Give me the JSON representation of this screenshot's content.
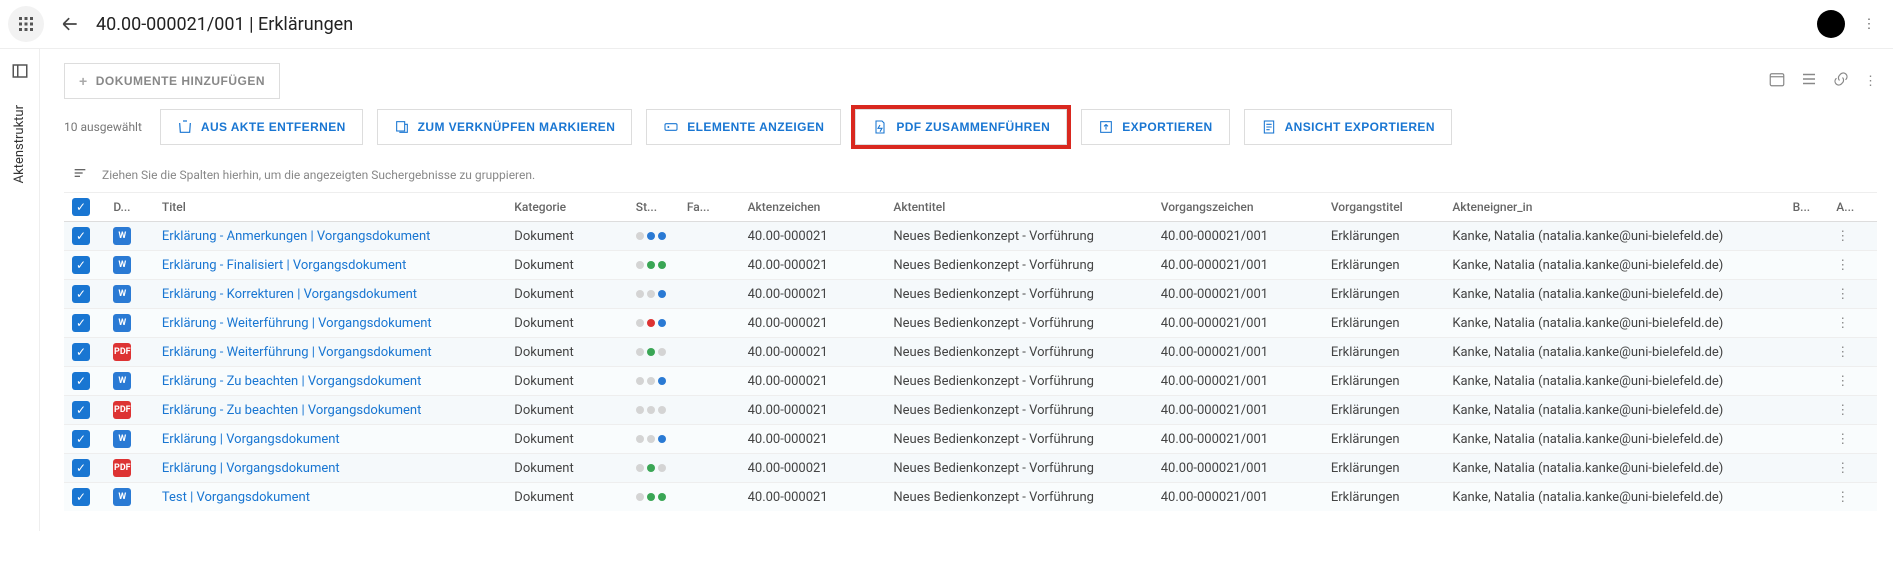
{
  "header": {
    "title": "40.00-000021/001 | Erklärungen"
  },
  "sidebar": {
    "vertical_label": "Aktenstruktur"
  },
  "toolbar": {
    "add_documents": "DOKUMENTE HINZUFÜGEN",
    "selected_count": "10 ausgewählt",
    "remove_from_file": "AUS AKTE ENTFERNEN",
    "mark_for_link": "ZUM VERKNÜPFEN MARKIEREN",
    "show_elements": "ELEMENTE ANZEIGEN",
    "merge_pdf": "PDF ZUSAMMENFÜHREN",
    "export": "EXPORTIEREN",
    "export_view": "ANSICHT EXPORTIEREN"
  },
  "grouper_hint": "Ziehen Sie die Spalten hierhin, um die angezeigten Suchergebnisse zu gruppieren.",
  "columns": {
    "d": "D...",
    "title": "Titel",
    "kategorie": "Kategorie",
    "st": "St...",
    "fa": "Fa...",
    "aktenzeichen": "Aktenzeichen",
    "aktentitel": "Aktentitel",
    "vorgangszeichen": "Vorgangszeichen",
    "vorgangstitel": "Vorgangstitel",
    "owner": "Akteneigner_in",
    "b": "B...",
    "a": "A..."
  },
  "rows": [
    {
      "icon": "w",
      "title": "Erklärung - Anmerkungen | Vorgangsdokument",
      "kat": "Dokument",
      "dots": [
        "grey",
        "blue",
        "blue"
      ],
      "az": "40.00-000021",
      "at": "Neues Bedienkonzept - Vorführung",
      "vz": "40.00-000021/001",
      "vt": "Erklärungen",
      "owner": "Kanke, Natalia (natalia.kanke@uni-bielefeld.de)"
    },
    {
      "icon": "w",
      "title": "Erklärung - Finalisiert | Vorgangsdokument",
      "kat": "Dokument",
      "dots": [
        "grey",
        "green",
        "green"
      ],
      "az": "40.00-000021",
      "at": "Neues Bedienkonzept - Vorführung",
      "vz": "40.00-000021/001",
      "vt": "Erklärungen",
      "owner": "Kanke, Natalia (natalia.kanke@uni-bielefeld.de)"
    },
    {
      "icon": "w",
      "title": "Erklärung - Korrekturen | Vorgangsdokument",
      "kat": "Dokument",
      "dots": [
        "grey",
        "grey",
        "blue"
      ],
      "az": "40.00-000021",
      "at": "Neues Bedienkonzept - Vorführung",
      "vz": "40.00-000021/001",
      "vt": "Erklärungen",
      "owner": "Kanke, Natalia (natalia.kanke@uni-bielefeld.de)"
    },
    {
      "icon": "w",
      "title": "Erklärung - Weiterführung | Vorgangsdokument",
      "kat": "Dokument",
      "dots": [
        "grey",
        "red",
        "blue"
      ],
      "az": "40.00-000021",
      "at": "Neues Bedienkonzept - Vorführung",
      "vz": "40.00-000021/001",
      "vt": "Erklärungen",
      "owner": "Kanke, Natalia (natalia.kanke@uni-bielefeld.de)"
    },
    {
      "icon": "pdf",
      "title": "Erklärung - Weiterführung | Vorgangsdokument",
      "kat": "Dokument",
      "dots": [
        "grey",
        "green",
        "grey"
      ],
      "az": "40.00-000021",
      "at": "Neues Bedienkonzept - Vorführung",
      "vz": "40.00-000021/001",
      "vt": "Erklärungen",
      "owner": "Kanke, Natalia (natalia.kanke@uni-bielefeld.de)"
    },
    {
      "icon": "w",
      "title": "Erklärung - Zu beachten | Vorgangsdokument",
      "kat": "Dokument",
      "dots": [
        "grey",
        "grey",
        "blue"
      ],
      "az": "40.00-000021",
      "at": "Neues Bedienkonzept - Vorführung",
      "vz": "40.00-000021/001",
      "vt": "Erklärungen",
      "owner": "Kanke, Natalia (natalia.kanke@uni-bielefeld.de)"
    },
    {
      "icon": "pdf",
      "title": "Erklärung - Zu beachten | Vorgangsdokument",
      "kat": "Dokument",
      "dots": [
        "grey",
        "grey",
        "grey"
      ],
      "az": "40.00-000021",
      "at": "Neues Bedienkonzept - Vorführung",
      "vz": "40.00-000021/001",
      "vt": "Erklärungen",
      "owner": "Kanke, Natalia (natalia.kanke@uni-bielefeld.de)"
    },
    {
      "icon": "w",
      "title": "Erklärung | Vorgangsdokument",
      "kat": "Dokument",
      "dots": [
        "grey",
        "grey",
        "blue"
      ],
      "az": "40.00-000021",
      "at": "Neues Bedienkonzept - Vorführung",
      "vz": "40.00-000021/001",
      "vt": "Erklärungen",
      "owner": "Kanke, Natalia (natalia.kanke@uni-bielefeld.de)"
    },
    {
      "icon": "pdf",
      "title": "Erklärung | Vorgangsdokument",
      "kat": "Dokument",
      "dots": [
        "grey",
        "green",
        "grey"
      ],
      "az": "40.00-000021",
      "at": "Neues Bedienkonzept - Vorführung",
      "vz": "40.00-000021/001",
      "vt": "Erklärungen",
      "owner": "Kanke, Natalia (natalia.kanke@uni-bielefeld.de)"
    },
    {
      "icon": "w",
      "title": "Test | Vorgangsdokument",
      "kat": "Dokument",
      "dots": [
        "grey",
        "green",
        "green"
      ],
      "az": "40.00-000021",
      "at": "Neues Bedienkonzept - Vorführung",
      "vz": "40.00-000021/001",
      "vt": "Erklärungen",
      "owner": "Kanke, Natalia (natalia.kanke@uni-bielefeld.de)"
    }
  ]
}
